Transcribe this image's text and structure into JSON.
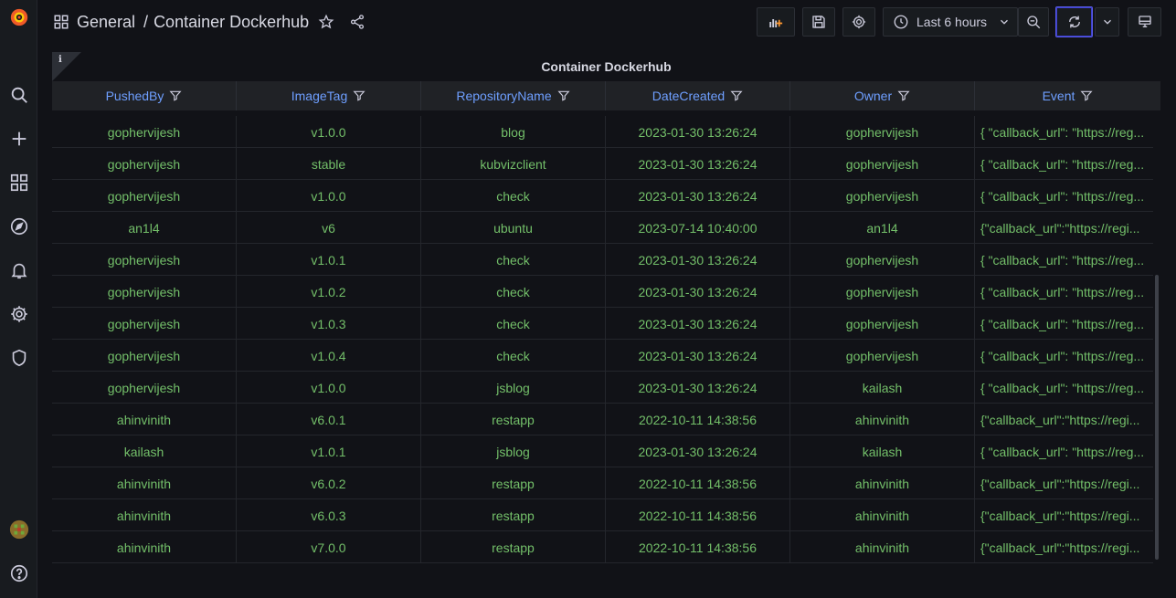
{
  "breadcrumb": {
    "folder": "General",
    "separator": "/",
    "dashboard": "Container Dockerhub"
  },
  "toolbar": {
    "time_range": "Last 6 hours"
  },
  "panel": {
    "title": "Container Dockerhub",
    "info_glyph": "i"
  },
  "table": {
    "columns": [
      "PushedBy",
      "ImageTag",
      "RepositoryName",
      "DateCreated",
      "Owner",
      "Event"
    ],
    "rows": [
      [
        "gophervijesh",
        "v1.0.0",
        "blog",
        "2023-01-30 13:26:24",
        "gophervijesh",
        "{ \"callback_url\": \"https://reg..."
      ],
      [
        "gophervijesh",
        "stable",
        "kubvizclient",
        "2023-01-30 13:26:24",
        "gophervijesh",
        "{ \"callback_url\": \"https://reg..."
      ],
      [
        "gophervijesh",
        "v1.0.0",
        "check",
        "2023-01-30 13:26:24",
        "gophervijesh",
        "{ \"callback_url\": \"https://reg..."
      ],
      [
        "an1l4",
        "v6",
        "ubuntu",
        "2023-07-14 10:40:00",
        "an1l4",
        "{\"callback_url\":\"https://regi..."
      ],
      [
        "gophervijesh",
        "v1.0.1",
        "check",
        "2023-01-30 13:26:24",
        "gophervijesh",
        "{ \"callback_url\": \"https://reg..."
      ],
      [
        "gophervijesh",
        "v1.0.2",
        "check",
        "2023-01-30 13:26:24",
        "gophervijesh",
        "{ \"callback_url\": \"https://reg..."
      ],
      [
        "gophervijesh",
        "v1.0.3",
        "check",
        "2023-01-30 13:26:24",
        "gophervijesh",
        "{ \"callback_url\": \"https://reg..."
      ],
      [
        "gophervijesh",
        "v1.0.4",
        "check",
        "2023-01-30 13:26:24",
        "gophervijesh",
        "{ \"callback_url\": \"https://reg..."
      ],
      [
        "gophervijesh",
        "v1.0.0",
        "jsblog",
        "2023-01-30 13:26:24",
        "kailash",
        "{ \"callback_url\": \"https://reg..."
      ],
      [
        "ahinvinith",
        "v6.0.1",
        "restapp",
        "2022-10-11 14:38:56",
        "ahinvinith",
        "{\"callback_url\":\"https://regi..."
      ],
      [
        "kailash",
        "v1.0.1",
        "jsblog",
        "2023-01-30 13:26:24",
        "kailash",
        "{ \"callback_url\": \"https://reg..."
      ],
      [
        "ahinvinith",
        "v6.0.2",
        "restapp",
        "2022-10-11 14:38:56",
        "ahinvinith",
        "{\"callback_url\":\"https://regi..."
      ],
      [
        "ahinvinith",
        "v6.0.3",
        "restapp",
        "2022-10-11 14:38:56",
        "ahinvinith",
        "{\"callback_url\":\"https://regi..."
      ],
      [
        "ahinvinith",
        "v7.0.0",
        "restapp",
        "2022-10-11 14:38:56",
        "ahinvinith",
        "{\"callback_url\":\"https://regi..."
      ]
    ]
  },
  "colors": {
    "background": "#111217",
    "sidebar": "#181b1f",
    "header_text": "#6e9fff",
    "cell_text": "#73bf69",
    "grafana_orange": "#f05a28"
  }
}
